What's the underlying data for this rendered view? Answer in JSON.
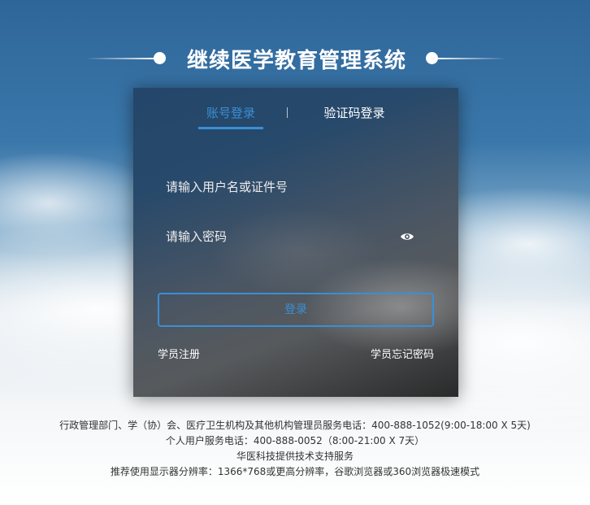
{
  "header": {
    "title": "继续医学教育管理系统"
  },
  "login": {
    "tabs": {
      "account": "账号登录",
      "code": "验证码登录"
    },
    "username_placeholder": "请输入用户名或证件号",
    "password_placeholder": "请输入密码",
    "login_button": "登录",
    "register_link": "学员注册",
    "forgot_link": "学员忘记密码",
    "icons": {
      "password_toggle": "eye-icon"
    }
  },
  "footer": {
    "line1": "行政管理部门、学（协）会、医疗卫生机构及其他机构管理员服务电话：400-888-1052(9:00-18:00 X 5天)",
    "line2": "个人用户服务电话：400-888-0052（8:00-21:00 X 7天）",
    "line3": "华医科技提供技术支持服务",
    "line4": "推荐使用显示器分辨率：1366*768或更高分辨率，谷歌浏览器或360浏览器极速模式"
  },
  "colors": {
    "accent": "#3a8fd6",
    "title_text": "#ffffff",
    "footer_text": "#333333"
  }
}
